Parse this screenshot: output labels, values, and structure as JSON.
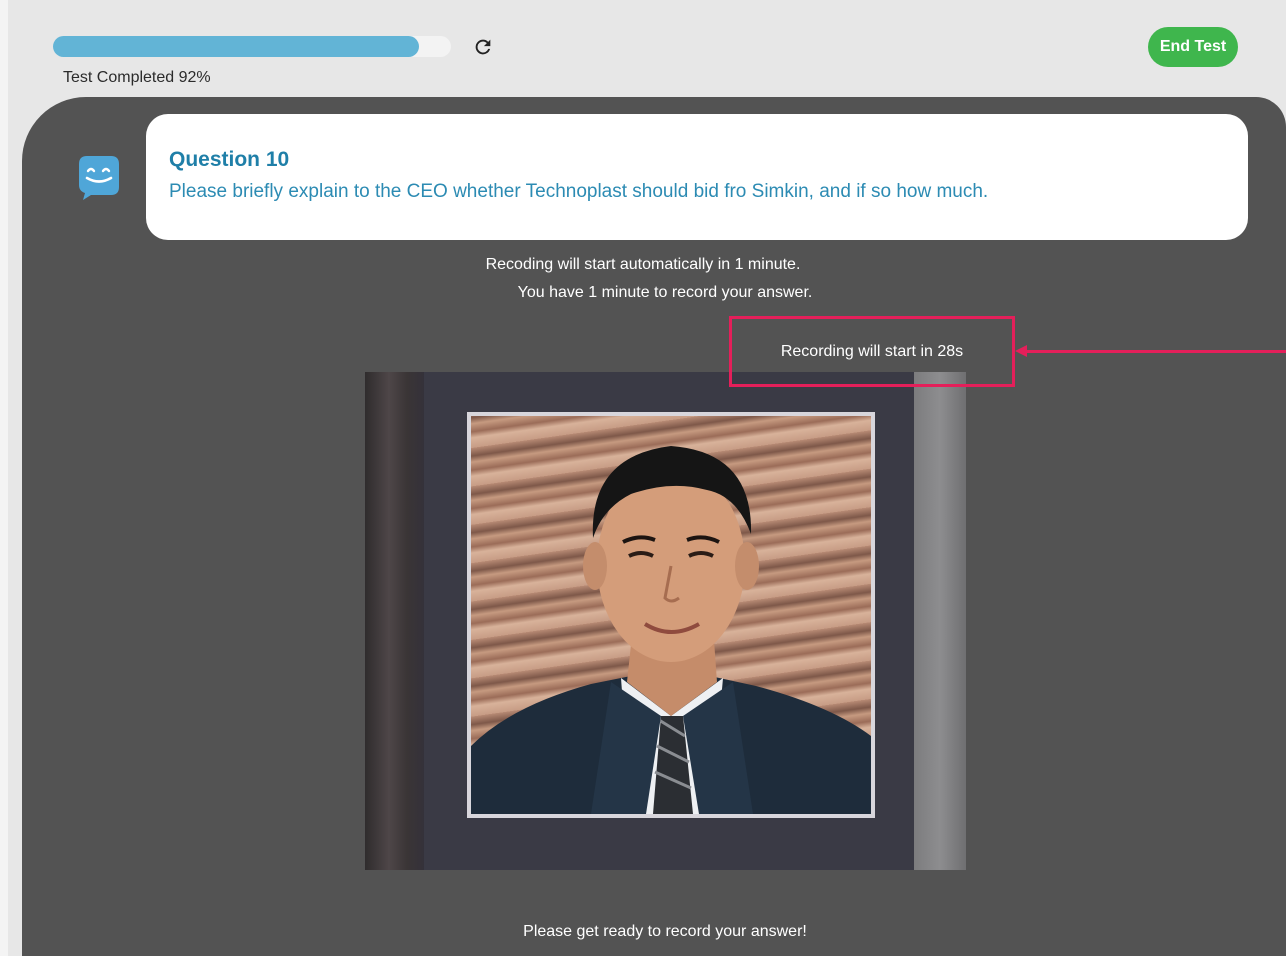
{
  "header": {
    "progress_label": "Test Completed 92%",
    "progress_fraction": 0.92,
    "end_test_label": "End Test",
    "refresh_icon": "refresh-icon"
  },
  "question": {
    "title": "Question 10",
    "text": "Please briefly explain to the CEO whether Technoplast should bid fro Simkin, and if so how much."
  },
  "info": {
    "line1": "Recoding will start automatically in 1 minute.",
    "line2": "You have 1 minute to record your answer.",
    "countdown": "Recording will start in  28s"
  },
  "footer": {
    "ready_text": "Please get ready to record your answer!"
  },
  "colors": {
    "accent_blue": "#62b4d6",
    "end_button_green": "#3fb64d",
    "highlight_red": "#e41f5a",
    "panel_dark": "#535353",
    "question_blue": "#1f7fa8"
  },
  "icons": {
    "bot": "chat-bot-icon",
    "refresh": "refresh-icon",
    "arrow": "arrow-left-icon"
  }
}
